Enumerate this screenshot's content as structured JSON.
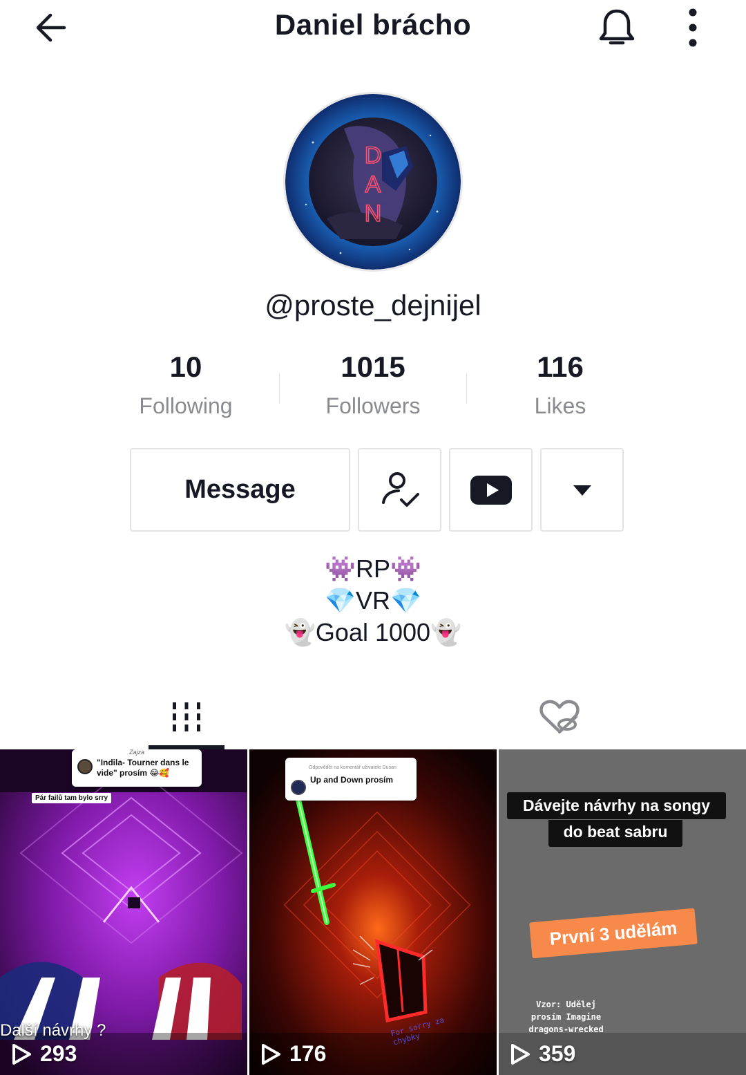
{
  "header": {
    "title": "Daniel brácho"
  },
  "profile": {
    "username": "@proste_dejnijel",
    "avatar_text": "DAN"
  },
  "stats": {
    "following": {
      "value": "10",
      "label": "Following"
    },
    "followers": {
      "value": "1015",
      "label": "Followers"
    },
    "likes": {
      "value": "116",
      "label": "Likes"
    }
  },
  "actions": {
    "message_label": "Message"
  },
  "bio": {
    "line1": "👾RP👾",
    "line2": "💎VR💎",
    "line3": "👻Goal 1000👻"
  },
  "videos": [
    {
      "views": "293",
      "reply_author": "Zajza",
      "reply_text": "\"Indila- Tourner dans le vide\" prosím 😂🥰",
      "overlay_small": "Pár failů tam bylo srry",
      "overlay_bottom": "Další návrhy ?"
    },
    {
      "views": "176",
      "reply_header": "Odpovědět na komentář uživatele Dusan",
      "reply_text": "Up and Down prosím",
      "overlay_bottom": "For sorry za chybky"
    },
    {
      "views": "359",
      "caption_line1": "Dávejte návrhy na songy",
      "caption_line2": "do beat sabru",
      "orange_label": "První 3 udělám",
      "note": "Vzor: Udělej prosím Imagine dragons-wrecked"
    }
  ],
  "colors": {
    "text_primary": "#161823",
    "text_secondary": "#8a8b91",
    "border": "#e3e3e4",
    "orange": "#f7894a"
  }
}
